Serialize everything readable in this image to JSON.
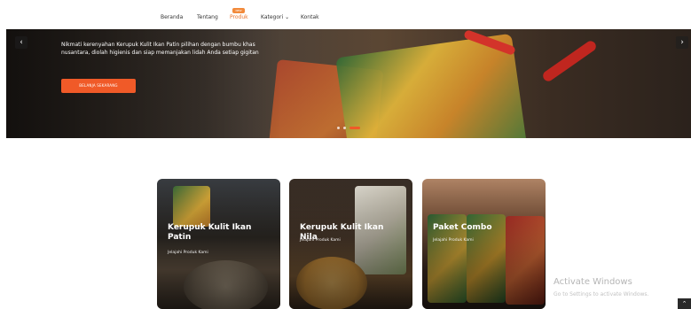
{
  "nav": {
    "items": [
      "Beranda",
      "Tentang",
      "Produk",
      "Kategori ⌄",
      "Kontak"
    ],
    "badge": "NEW"
  },
  "hero": {
    "description": "Nikmati kerenyahan Kerupuk Kulit Ikan Patin pilihan dengan bumbu khas nusantara, diolah higienis dan siap memanjakan lidah Anda setiap gigitan",
    "cta": "BELANJA SEKARANG",
    "prev_icon": "chevron-left-icon",
    "next_icon": "chevron-right-icon",
    "active_slide": 3
  },
  "cards": [
    {
      "title": "Kerupuk Kulit Ikan Patin",
      "subtitle": "Jelajahi Produk Kami"
    },
    {
      "title": "Kerupuk Kulit Ikan Nila",
      "subtitle": "Jelajahi Produk Kami"
    },
    {
      "title": "Paket Combo",
      "subtitle": "Jelajahi Produk Kami"
    }
  ],
  "watermark": {
    "title": "Activate Windows",
    "subtitle": "Go to Settings to activate Windows."
  },
  "colors": {
    "accent": "#f05a28",
    "nav_active": "#e8732c"
  }
}
